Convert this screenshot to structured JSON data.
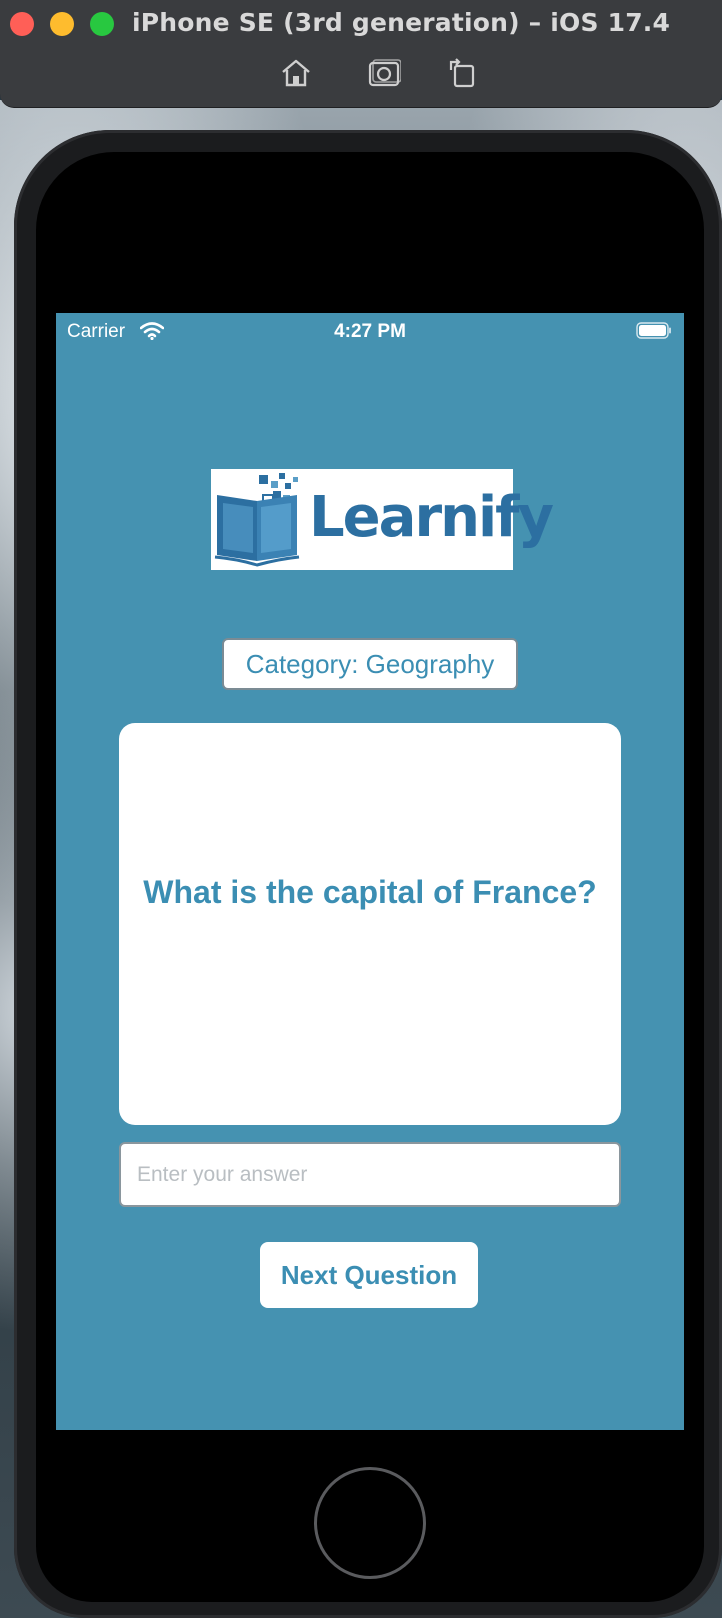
{
  "window": {
    "title": "iPhone SE (3rd generation) – iOS 17.4",
    "toolbar": [
      {
        "name": "home",
        "icon": "house-icon"
      },
      {
        "name": "screenshot",
        "icon": "camera-icon"
      },
      {
        "name": "rotate",
        "icon": "rotate-icon"
      }
    ]
  },
  "status_bar": {
    "carrier": "Carrier",
    "time": "4:27 PM"
  },
  "app": {
    "logo_text": "Learnify",
    "category_label": "Category: Geography",
    "question": "What is the capital of France?",
    "answer_placeholder": "Enter your answer",
    "answer_value": "",
    "next_button_label": "Next Question"
  },
  "colors": {
    "screen_background": "#4592b1",
    "accent": "#3b8eb3",
    "logo_blue": "#2c6fa1"
  }
}
